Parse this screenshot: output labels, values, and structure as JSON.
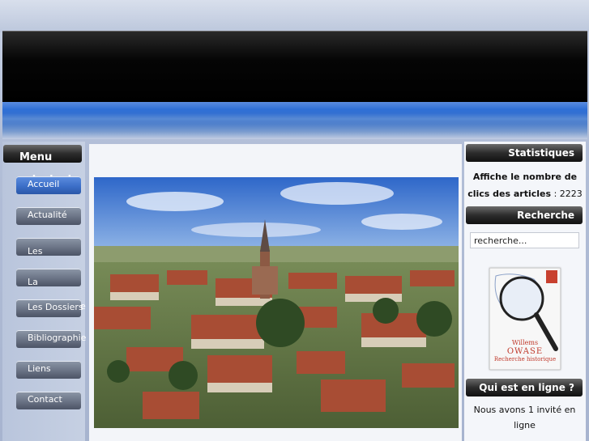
{
  "menu": {
    "title": "Menu principal",
    "items": [
      {
        "label": "Accueil",
        "active": true
      },
      {
        "label": "Actualité",
        "active": false
      },
      {
        "label": "Les Expositions",
        "active": false
      },
      {
        "label": "La Médiathèque",
        "active": false
      },
      {
        "label": "Les Dossiers",
        "active": false
      },
      {
        "label": "Bibliographie",
        "active": false
      },
      {
        "label": "Liens",
        "active": false
      },
      {
        "label": "Contact",
        "active": false
      }
    ]
  },
  "stats": {
    "title": "Statistiques",
    "label": "Affiche le nombre de clics des articles",
    "separator": " : ",
    "value": "2223"
  },
  "search": {
    "title": "Recherche",
    "value": "recherche..."
  },
  "book": {
    "line1": "Willems",
    "line2": "OWASE",
    "line3": "Recherche historique"
  },
  "online": {
    "title": "Qui est en ligne ?",
    "text": "Nous avons 1 invité en ligne"
  },
  "colors": {
    "accent_blue": "#3c6fc8",
    "header_black": "#000000"
  }
}
